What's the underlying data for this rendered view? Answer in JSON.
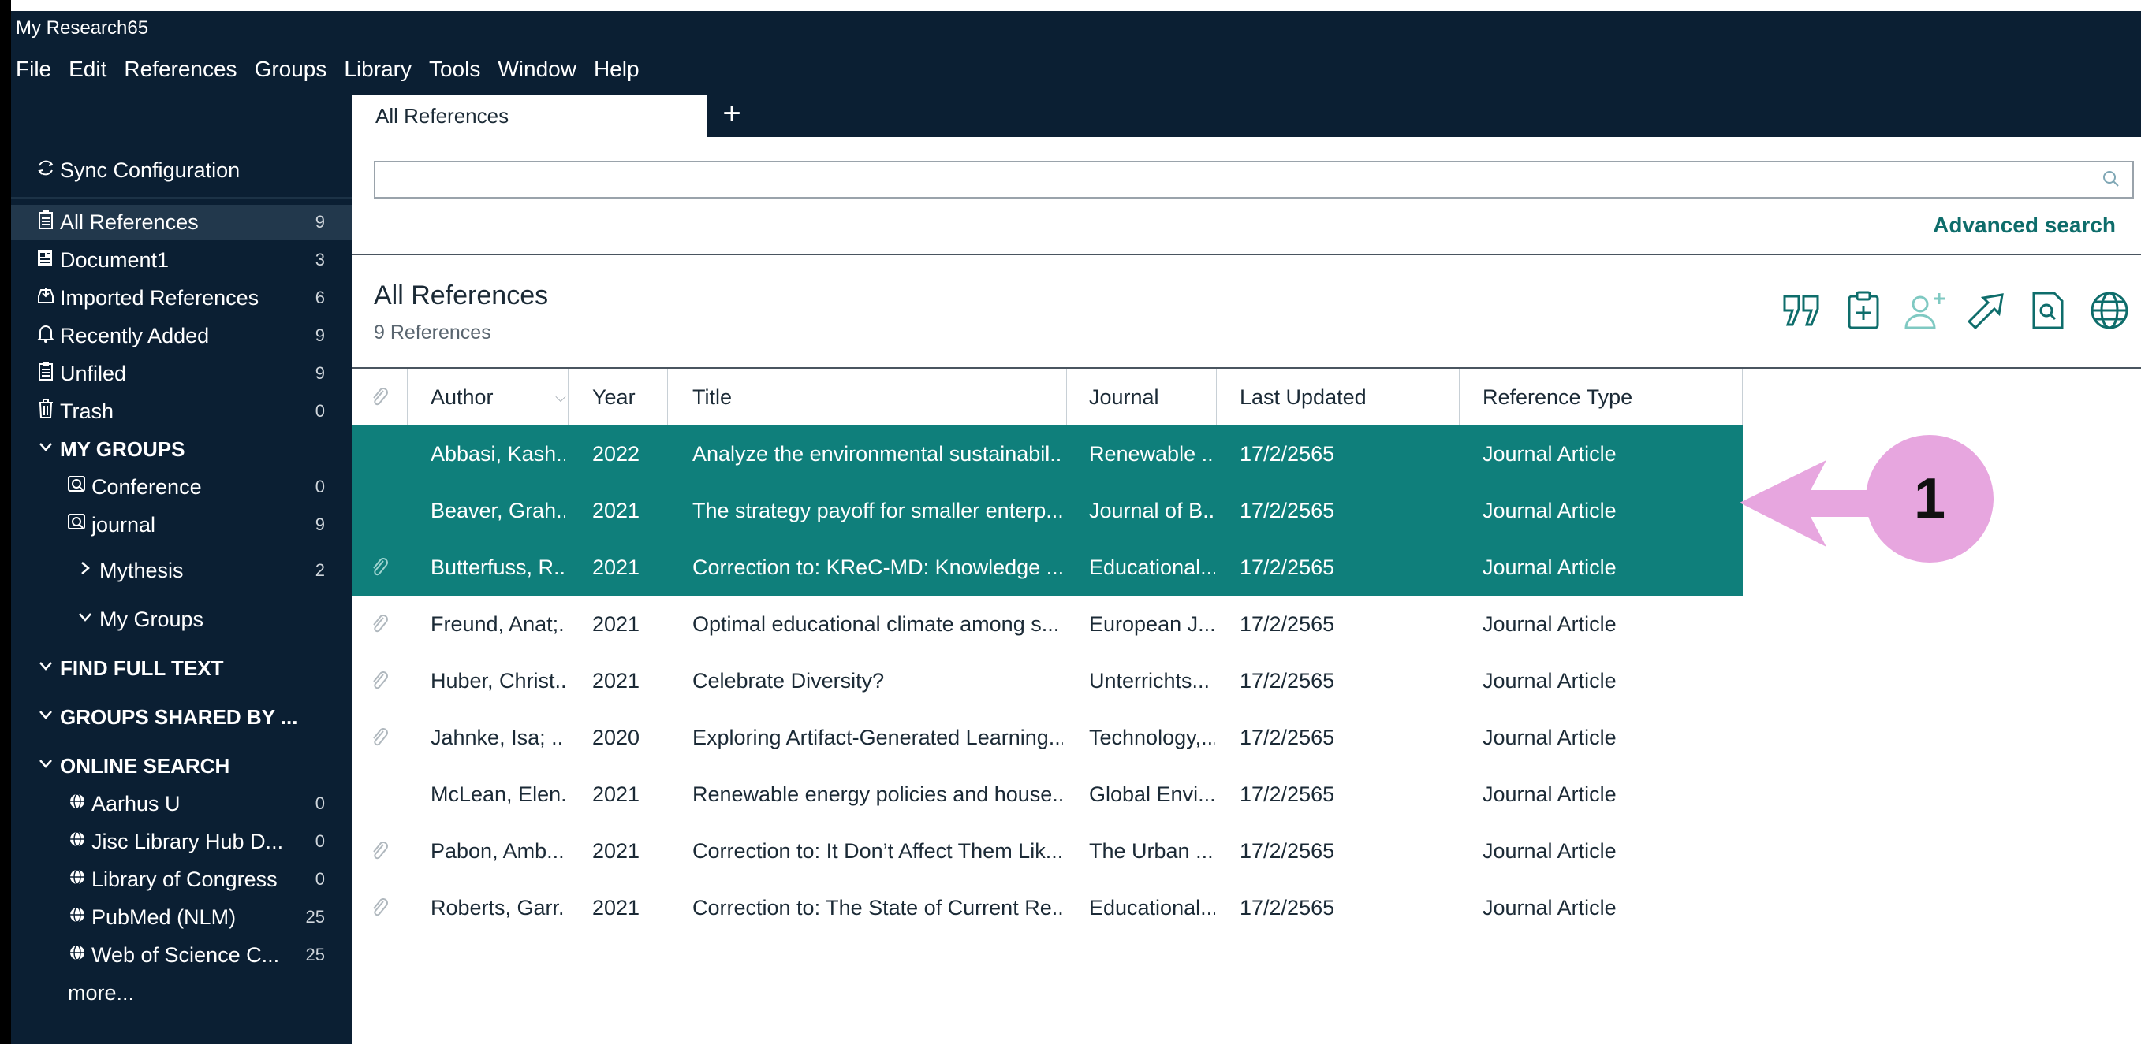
{
  "window": {
    "title": "My Research65"
  },
  "menu": [
    "File",
    "Edit",
    "References",
    "Groups",
    "Library",
    "Tools",
    "Window",
    "Help"
  ],
  "tabs": {
    "active": "All References",
    "add_label": "+"
  },
  "sidebar": {
    "sync": {
      "label": "Sync Configuration",
      "icon": "sync-icon"
    },
    "libraries": [
      {
        "label": "All References",
        "count": "9",
        "icon": "clipboard-icon"
      },
      {
        "label": "Document1",
        "count": "3",
        "icon": "document-icon"
      },
      {
        "label": "Imported References",
        "count": "6",
        "icon": "import-icon"
      },
      {
        "label": "Recently Added",
        "count": "9",
        "icon": "bell-icon"
      },
      {
        "label": "Unfiled",
        "count": "9",
        "icon": "clipboard-icon"
      },
      {
        "label": "Trash",
        "count": "0",
        "icon": "trash-icon"
      }
    ],
    "my_groups": {
      "heading": "MY GROUPS",
      "items": [
        {
          "label": "Conference",
          "count": "0",
          "icon": "group-search-icon"
        },
        {
          "label": "journal",
          "count": "9",
          "icon": "group-search-icon"
        }
      ],
      "mythesis": {
        "label": "Mythesis",
        "count": "2"
      },
      "my_groups_sub": {
        "label": "My Groups"
      }
    },
    "find_full_text": {
      "heading": "FIND FULL TEXT"
    },
    "groups_shared": {
      "heading": "GROUPS SHARED BY ..."
    },
    "online_search": {
      "heading": "ONLINE SEARCH",
      "items": [
        {
          "label": "Aarhus U",
          "count": "0"
        },
        {
          "label": "Jisc Library Hub D...",
          "count": "0"
        },
        {
          "label": "Library of Congress",
          "count": "0"
        },
        {
          "label": "PubMed (NLM)",
          "count": "25"
        },
        {
          "label": "Web of Science C...",
          "count": "25"
        }
      ],
      "more": "more..."
    }
  },
  "search": {
    "placeholder": "",
    "advanced": "Advanced search"
  },
  "library": {
    "title": "All References",
    "count": "9 References"
  },
  "table": {
    "headers": {
      "author": "Author",
      "year": "Year",
      "title": "Title",
      "journal": "Journal",
      "updated": "Last Updated",
      "type": "Reference Type"
    },
    "rows": [
      {
        "attach": false,
        "author": "Abbasi, Kash...",
        "year": "2022",
        "title": "Analyze the environmental sustainabil...",
        "journal": "Renewable ...",
        "updated": "17/2/2565",
        "type": "Journal Article",
        "selected": true
      },
      {
        "attach": false,
        "author": "Beaver, Grah...",
        "year": "2021",
        "title": "The strategy payoff for smaller enterp...",
        "journal": "Journal of B...",
        "updated": "17/2/2565",
        "type": "Journal Article",
        "selected": true
      },
      {
        "attach": true,
        "author": "Butterfuss, R...",
        "year": "2021",
        "title": "Correction to: KReC-MD: Knowledge ...",
        "journal": "Educational...",
        "updated": "17/2/2565",
        "type": "Journal Article",
        "selected": true
      },
      {
        "attach": true,
        "author": "Freund, Anat;...",
        "year": "2021",
        "title": "Optimal educational climate among s...",
        "journal": "European J...",
        "updated": "17/2/2565",
        "type": "Journal Article",
        "selected": false
      },
      {
        "attach": true,
        "author": "Huber, Christ...",
        "year": "2021",
        "title": "Celebrate Diversity?",
        "journal": "Unterrichts...",
        "updated": "17/2/2565",
        "type": "Journal Article",
        "selected": false
      },
      {
        "attach": true,
        "author": "Jahnke, Isa; ...",
        "year": "2020",
        "title": "Exploring Artifact-Generated Learning...",
        "journal": "Technology,...",
        "updated": "17/2/2565",
        "type": "Journal Article",
        "selected": false
      },
      {
        "attach": false,
        "author": "McLean, Elen...",
        "year": "2021",
        "title": "Renewable energy policies and house...",
        "journal": "Global Envi...",
        "updated": "17/2/2565",
        "type": "Journal Article",
        "selected": false
      },
      {
        "attach": true,
        "author": "Pabon, Amb...",
        "year": "2021",
        "title": "Correction to: It Don’t Affect Them Lik...",
        "journal": "The Urban ...",
        "updated": "17/2/2565",
        "type": "Journal Article",
        "selected": false
      },
      {
        "attach": true,
        "author": "Roberts, Garr...",
        "year": "2021",
        "title": "Correction to: The State of Current Re...",
        "journal": "Educational...",
        "updated": "17/2/2565",
        "type": "Journal Article",
        "selected": false
      }
    ]
  },
  "toolbar": [
    "quote-icon",
    "insert-citation-icon",
    "add-user-icon",
    "share-icon",
    "find-in-pdf-icon",
    "globe-icon"
  ],
  "annotation": {
    "label": "1"
  },
  "colors": {
    "navy": "#0b1f33",
    "selected_row": "#0f7f7b",
    "accent": "#0e6d6b",
    "annotation": "#e7a6df"
  }
}
